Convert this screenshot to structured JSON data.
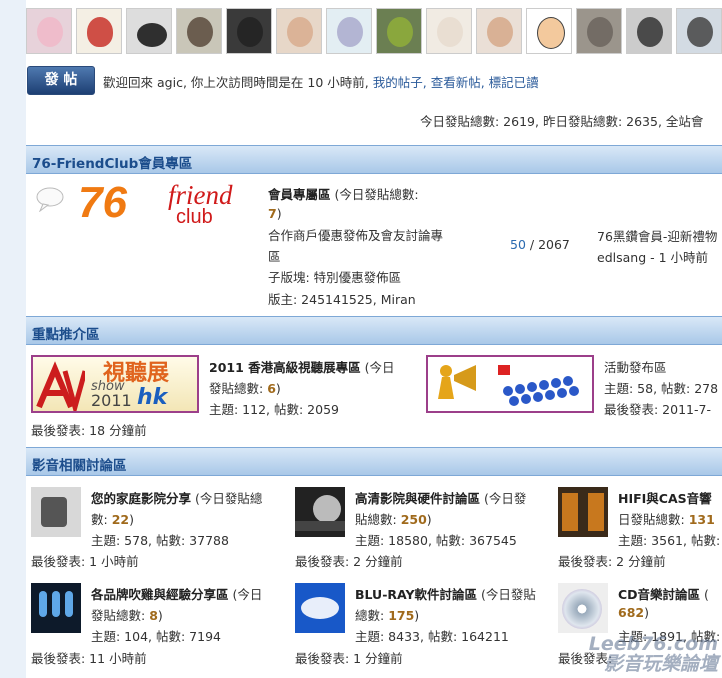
{
  "toolbar": {
    "post_label": "發 帖"
  },
  "welcome": {
    "prefix": "歡迎回來",
    "user": "agic,",
    "middle": "你上次訪問時間是在  10 小時前,",
    "my_posts": "我的帖子,",
    "new_posts": "查看新帖,",
    "mark_read": "標記已讀"
  },
  "stats": {
    "text": "今日發貼總數: 2619, 昨日發貼總數: 2635, 全站會"
  },
  "categories": [
    {
      "title": "76-FriendClub會員專區"
    },
    {
      "title": "重點推介區"
    },
    {
      "title": "影音相關討論區"
    }
  ],
  "club": {
    "logo_num": "76",
    "logo_friend": "friend",
    "logo_club": "club",
    "title": "會員專屬區",
    "today_pre": "(今日發貼總數:",
    "today_num": "7",
    "today_post": ")",
    "desc1": "合作商戶優惠發佈及會友討論專",
    "desc2": "區",
    "sub": "子版塊: 特別優惠發佈區",
    "mods": "版主: 245141525, Miran",
    "count_a": "50",
    "count_slash": " / 2067",
    "last_title": "76黑鑽會員-迎新禮物",
    "last_info": "edlsang - 1 小時前"
  },
  "featured": [
    {
      "banner_top": "視聽展",
      "banner_show": "show",
      "banner_year": "2011",
      "banner_hk": "hk",
      "title": "2011 香港高級視聽展專區",
      "today_pre": "(今日",
      "today_line2": "發貼總數:",
      "today_num": "6",
      "today_post": ")",
      "topics": "主題: 112, 帖數: 2059",
      "last": "最後發表: 18 分鐘前"
    },
    {
      "title": "活動發布區",
      "topics": "主題: 58, 帖數: 278",
      "last": "最後發表: 2011-7-"
    }
  ],
  "forums": [
    {
      "title": "您的家庭影院分享",
      "today_pre": "(今日發貼總",
      "today_line2": "數:",
      "today_num": "22",
      "today_post": ")",
      "topics": "主題: 578, 帖數: 37788",
      "last": "最後發表: 1 小時前"
    },
    {
      "title": "高清影院與硬件討論區",
      "today_pre": "(今日發",
      "today_line2": "貼總數:",
      "today_num": "250",
      "today_post": ")",
      "topics": "主題: 18580, 帖數: 367545",
      "last": "最後發表: 2 分鐘前"
    },
    {
      "title": "HIFI與CAS音響",
      "today_pre": "",
      "today_line2": "日發貼總數:",
      "today_num": "131",
      "today_post": "",
      "topics": "主題: 3561, 帖數:",
      "last": "最後發表: 2 分鐘前"
    },
    {
      "title": "各品牌吹雞與經驗分享區",
      "today_pre": "(今日",
      "today_line2": "發貼總數:",
      "today_num": "8",
      "today_post": ")",
      "topics": "主題: 104, 帖數: 7194",
      "last": "最後發表: 11 小時前"
    },
    {
      "title": "BLU-RAY軟件討論區",
      "today_pre": "(今日發貼",
      "today_line2": "總數:",
      "today_num": "175",
      "today_post": ")",
      "topics": "主題: 8433, 帖數: 164211",
      "last": "最後發表: 1 分鐘前"
    },
    {
      "title": "CD音樂討論區",
      "today_pre": "(",
      "today_line2": "",
      "today_num": "682",
      "today_post": ")",
      "topics": "主題: 1891, 帖數:",
      "last": "最後發表:"
    }
  ],
  "watermark": {
    "line1": "Leeb76.com",
    "line2": "影音玩樂論壇"
  },
  "colors": {
    "category_text": "#1c4d8c",
    "link": "#2a5a9a",
    "count": "#a06a1c"
  }
}
